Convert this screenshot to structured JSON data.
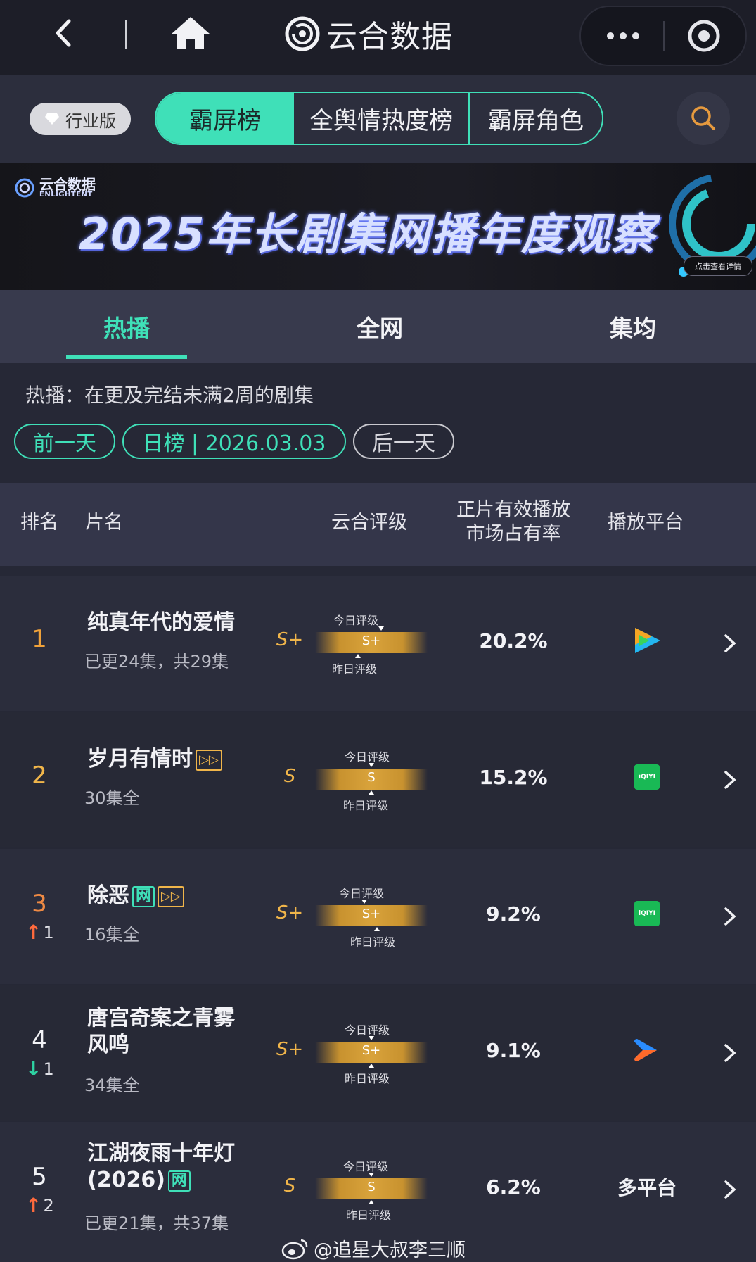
{
  "nav": {
    "brand": "云合数据"
  },
  "filters": {
    "industry_badge": "行业版",
    "segments": [
      "霸屏榜",
      "全舆情热度榜",
      "霸屏角色"
    ]
  },
  "banner": {
    "logo_cn": "云合数据",
    "logo_en": "ENLIGHTENT",
    "title": "2025年长剧集网播年度观察",
    "cta": "点击查看详情"
  },
  "tabs": [
    "热播",
    "全网",
    "集均"
  ],
  "description": "热播：在更及完结未满2周的剧集",
  "date_nav": {
    "prev": "前一天",
    "current": "日榜 | 2026.03.03",
    "next": "后一天"
  },
  "table_header": {
    "rank": "排名",
    "name": "片名",
    "grade": "云合评级",
    "share_line1": "正片有效播放",
    "share_line2": "市场占有率",
    "platform": "播放平台"
  },
  "grade_labels": {
    "today": "今日评级",
    "yesterday": "昨日评级"
  },
  "rows": [
    {
      "rank": "1",
      "title": "纯真年代的爱情",
      "title2": "",
      "episodes": "已更24集，共29集",
      "grade": "S+",
      "bar_grade": "S+",
      "share": "20.2%",
      "platform": "tencent-video-icon",
      "platform_text": "",
      "change": "",
      "change_dir": ""
    },
    {
      "rank": "2",
      "title": "岁月有情时",
      "title2": "",
      "episodes": "30集全",
      "grade": "S",
      "bar_grade": "S",
      "share": "15.2%",
      "platform": "iqiyi-icon",
      "platform_text": "iQIYI",
      "change": "",
      "change_dir": ""
    },
    {
      "rank": "3",
      "title": "除恶",
      "title2": "",
      "episodes": "16集全",
      "grade": "S+",
      "bar_grade": "S+",
      "share": "9.2%",
      "platform": "iqiyi-icon",
      "platform_text": "iQIYI",
      "change": "1",
      "change_dir": "up"
    },
    {
      "rank": "4",
      "title": "唐宫奇案之青雾",
      "title2": "风鸣",
      "episodes": "34集全",
      "grade": "S+",
      "bar_grade": "S+",
      "share": "9.1%",
      "platform": "youku-icon",
      "platform_text": "",
      "change": "1",
      "change_dir": "down"
    },
    {
      "rank": "5",
      "title": "江湖夜雨十年灯",
      "title2": "(2026)",
      "episodes": "已更21集，共37集",
      "grade": "S",
      "bar_grade": "S",
      "share": "6.2%",
      "platform": "multi",
      "platform_text": "多平台",
      "change": "2",
      "change_dir": "up"
    }
  ],
  "tags": {
    "wang": "网"
  },
  "watermark": "@追星大叔李三顺",
  "colors": {
    "accent": "#3fe0b8",
    "gold": "#f0b54a",
    "rank_up": "#ff6a3d",
    "rank_down": "#2ed3a3"
  }
}
